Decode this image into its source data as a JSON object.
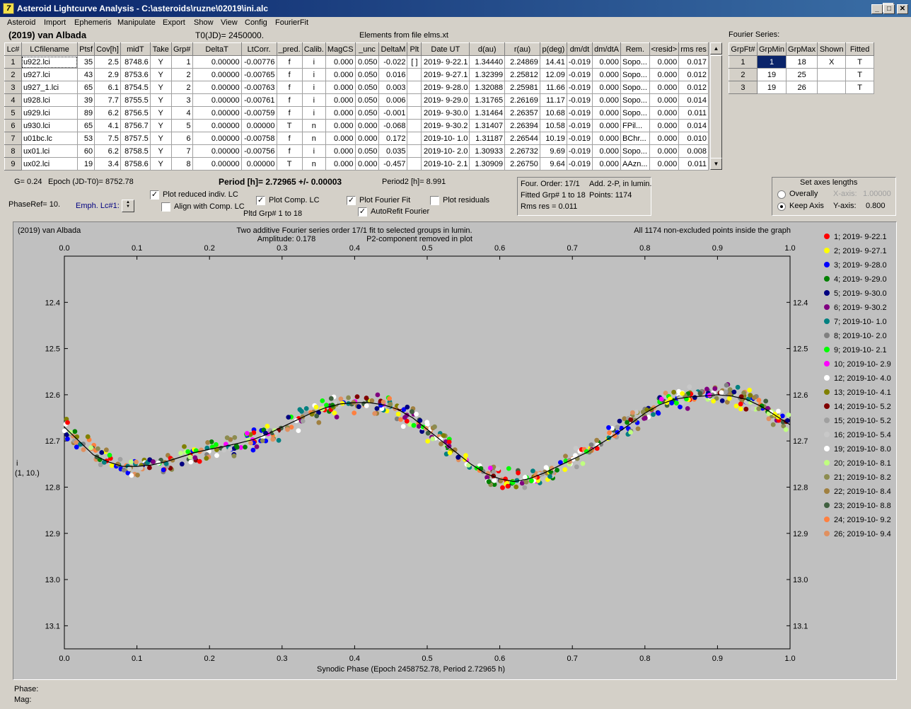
{
  "window": {
    "title": "Asteroid Lightcurve Analysis - C:\\asteroids\\ruzne\\02019\\ini.alc",
    "app_icon": "7"
  },
  "menu": [
    "Asteroid",
    "Import",
    "Ephemeris",
    "Manipulate",
    "Export",
    "Show",
    "View",
    "Config",
    "FourierFit"
  ],
  "header": {
    "asteroid": "(2019) van Albada",
    "t0": "T0(JD)= 2450000.",
    "elements": "Elements from file elms.xt",
    "fourier_title": "Fourier Series:"
  },
  "lc_table": {
    "columns": [
      "Lc#",
      "LCfilename",
      "Ptsf",
      "Cov[h]",
      "midT",
      "Take",
      "Grp#",
      "DeltaT",
      "LtCorr.",
      "_pred.",
      "Calib.",
      "MagCS",
      "_unc",
      "DeltaM",
      "Plt",
      "Date UT",
      "d(au)",
      "r(au)",
      "p(deg)",
      "dm/dt",
      "dm/dtA",
      "Rem.",
      "<resid>",
      "rms res"
    ],
    "rows": [
      [
        "1",
        "u922.lci",
        "35",
        "2.5",
        "8748.6",
        "Y",
        "1",
        "0.00000",
        "-0.00776",
        "f",
        "i",
        "0.000",
        "0.050",
        "-0.022",
        "[ ]",
        "2019- 9-22.1",
        "1.34440",
        "2.24869",
        "14.41",
        "-0.019",
        "0.000",
        "Sopo...",
        "0.000",
        "0.017"
      ],
      [
        "2",
        "u927.lci",
        "43",
        "2.9",
        "8753.6",
        "Y",
        "2",
        "0.00000",
        "-0.00765",
        "f",
        "i",
        "0.000",
        "0.050",
        "0.016",
        "",
        "2019- 9-27.1",
        "1.32399",
        "2.25812",
        "12.09",
        "-0.019",
        "0.000",
        "Sopo...",
        "0.000",
        "0.012"
      ],
      [
        "3",
        "u927_1.lci",
        "65",
        "6.1",
        "8754.5",
        "Y",
        "2",
        "0.00000",
        "-0.00763",
        "f",
        "i",
        "0.000",
        "0.050",
        "0.003",
        "",
        "2019- 9-28.0",
        "1.32088",
        "2.25981",
        "11.66",
        "-0.019",
        "0.000",
        "Sopo...",
        "0.000",
        "0.012"
      ],
      [
        "4",
        "u928.lci",
        "39",
        "7.7",
        "8755.5",
        "Y",
        "3",
        "0.00000",
        "-0.00761",
        "f",
        "i",
        "0.000",
        "0.050",
        "0.006",
        "",
        "2019- 9-29.0",
        "1.31765",
        "2.26169",
        "11.17",
        "-0.019",
        "0.000",
        "Sopo...",
        "0.000",
        "0.014"
      ],
      [
        "5",
        "u929.lci",
        "89",
        "6.2",
        "8756.5",
        "Y",
        "4",
        "0.00000",
        "-0.00759",
        "f",
        "i",
        "0.000",
        "0.050",
        "-0.001",
        "",
        "2019- 9-30.0",
        "1.31464",
        "2.26357",
        "10.68",
        "-0.019",
        "0.000",
        "Sopo...",
        "0.000",
        "0.011"
      ],
      [
        "6",
        "u930.lci",
        "65",
        "4.1",
        "8756.7",
        "Y",
        "5",
        "0.00000",
        "0.00000",
        "T",
        "n",
        "0.000",
        "0.000",
        "-0.068",
        "",
        "2019- 9-30.2",
        "1.31407",
        "2.26394",
        "10.58",
        "-0.019",
        "0.000",
        "FPil...",
        "0.000",
        "0.014"
      ],
      [
        "7",
        "u01bc.lc",
        "53",
        "7.5",
        "8757.5",
        "Y",
        "6",
        "0.00000",
        "-0.00758",
        "f",
        "n",
        "0.000",
        "0.000",
        "0.172",
        "",
        "2019-10- 1.0",
        "1.31187",
        "2.26544",
        "10.19",
        "-0.019",
        "0.000",
        "BChr...",
        "0.000",
        "0.010"
      ],
      [
        "8",
        "ux01.lci",
        "60",
        "6.2",
        "8758.5",
        "Y",
        "7",
        "0.00000",
        "-0.00756",
        "f",
        "i",
        "0.000",
        "0.050",
        "0.035",
        "",
        "2019-10- 2.0",
        "1.30933",
        "2.26732",
        "9.69",
        "-0.019",
        "0.000",
        "Sopo...",
        "0.000",
        "0.008"
      ],
      [
        "9",
        "ux02.lci",
        "19",
        "3.4",
        "8758.6",
        "Y",
        "8",
        "0.00000",
        "0.00000",
        "T",
        "n",
        "0.000",
        "0.000",
        "-0.457",
        "",
        "2019-10- 2.1",
        "1.30909",
        "2.26750",
        "9.64",
        "-0.019",
        "0.000",
        "AAzn...",
        "0.000",
        "0.011"
      ]
    ]
  },
  "fourier_table": {
    "columns": [
      "GrpFt#",
      "GrpMin",
      "GrpMax",
      "Shown",
      "Fitted"
    ],
    "rows": [
      [
        "1",
        "1",
        "18",
        "X",
        "T"
      ],
      [
        "2",
        "19",
        "25",
        "",
        "T"
      ],
      [
        "3",
        "19",
        "26",
        "",
        "T"
      ]
    ]
  },
  "info": {
    "g": "G= 0.24",
    "epoch": "Epoch (JD-T0)= 8752.78",
    "period": "Period [h]= 2.72965 +/- 0.00003",
    "period2": "Period2 [h]= 8.991",
    "phaseref": "PhaseRef= 10.",
    "emph": "Emph. Lc#1:",
    "plot_reduced": "Plot reduced indiv. LC",
    "align_comp": "Align with Comp. LC",
    "plot_comp": "Plot Comp. LC",
    "plot_fourier": "Plot Fourier Fit",
    "autorefit": "AutoRefit Fourier",
    "plot_residuals": "Plot residuals",
    "plotted_grp": "Pltd Grp#  1   to   18",
    "four_order": "Four. Order: 17/1",
    "add_2p": "Add. 2-P, in lumin.",
    "fitted_grp": "Fitted Grp# 1 to 18",
    "points": "Points: 1174",
    "rms": "Rms res      = 0.011",
    "axes_title": "Set axes lengths",
    "overally": "Overally",
    "keep_axis": "Keep Axis",
    "xaxis_label": "X-axis:",
    "xaxis_val": "1.00000",
    "yaxis_label": "Y-axis:",
    "yaxis_val": "0.800"
  },
  "checks": {
    "plot_reduced": true,
    "align_comp": false,
    "plot_comp": true,
    "plot_fourier": true,
    "autorefit": true,
    "plot_residuals": false,
    "keep_axis": true
  },
  "plot": {
    "left_title": "(2019) van Albada",
    "center_title": "Two additive Fourier series order 17/1 fit to selected groups in lumin.",
    "amplitude": "Amplitude: 0.178",
    "p2note": "P2-component removed in plot",
    "right_title": "All 1174 non-excluded points inside the graph",
    "xlabel": "Synodic Phase (Epoch 2458752.78, Period 2.72965 h)",
    "ylabel_1": "i",
    "ylabel_2": "(1, 10.)"
  },
  "status": {
    "phase": "Phase:",
    "mag": "Mag:"
  },
  "chart_data": {
    "type": "scatter",
    "xlim": [
      0.0,
      1.0
    ],
    "ylim": [
      12.3,
      13.15
    ],
    "y_inverted": true,
    "xticks": [
      "0.0",
      "0.1",
      "0.2",
      "0.3",
      "0.4",
      "0.5",
      "0.6",
      "0.7",
      "0.8",
      "0.9",
      "1.0"
    ],
    "yticks": [
      "12.4",
      "12.5",
      "12.6",
      "12.7",
      "12.8",
      "12.9",
      "13.0",
      "13.1"
    ],
    "fit_curve": {
      "x": [
        0.0,
        0.02,
        0.04,
        0.06,
        0.08,
        0.1,
        0.12,
        0.14,
        0.16,
        0.18,
        0.2,
        0.22,
        0.24,
        0.26,
        0.28,
        0.3,
        0.32,
        0.34,
        0.36,
        0.38,
        0.4,
        0.42,
        0.44,
        0.46,
        0.48,
        0.5,
        0.52,
        0.54,
        0.56,
        0.58,
        0.6,
        0.62,
        0.64,
        0.66,
        0.68,
        0.7,
        0.72,
        0.74,
        0.76,
        0.78,
        0.8,
        0.82,
        0.84,
        0.86,
        0.88,
        0.9,
        0.92,
        0.94,
        0.96,
        0.98,
        1.0
      ],
      "y": [
        12.67,
        12.7,
        12.73,
        12.745,
        12.755,
        12.755,
        12.752,
        12.745,
        12.735,
        12.725,
        12.718,
        12.712,
        12.705,
        12.697,
        12.685,
        12.67,
        12.655,
        12.64,
        12.628,
        12.62,
        12.617,
        12.617,
        12.622,
        12.632,
        12.65,
        12.675,
        12.7,
        12.725,
        12.75,
        12.77,
        12.782,
        12.788,
        12.782,
        12.77,
        12.755,
        12.74,
        12.725,
        12.705,
        12.685,
        12.663,
        12.64,
        12.622,
        12.61,
        12.605,
        12.603,
        12.6,
        12.603,
        12.61,
        12.625,
        12.645,
        12.665
      ]
    },
    "series": [
      {
        "name": "1; 2019- 9-22.1",
        "color": "#ff0000"
      },
      {
        "name": "2; 2019- 9-27.1",
        "color": "#ffff00"
      },
      {
        "name": "3; 2019- 9-28.0",
        "color": "#0000ff"
      },
      {
        "name": "4; 2019- 9-29.0",
        "color": "#008000"
      },
      {
        "name": "5; 2019- 9-30.0",
        "color": "#000080"
      },
      {
        "name": "6; 2019- 9-30.2",
        "color": "#800080"
      },
      {
        "name": "7; 2019-10- 1.0",
        "color": "#008080"
      },
      {
        "name": "8; 2019-10- 2.0",
        "color": "#808080"
      },
      {
        "name": "9; 2019-10- 2.1",
        "color": "#00ff00"
      },
      {
        "name": "10; 2019-10- 2.9",
        "color": "#ff00ff"
      },
      {
        "name": "12; 2019-10- 4.0",
        "color": "#ffffff"
      },
      {
        "name": "13; 2019-10- 4.1",
        "color": "#808000"
      },
      {
        "name": "14; 2019-10- 5.2",
        "color": "#800000"
      },
      {
        "name": "15; 2019-10- 5.2",
        "color": "#a0a0a0"
      },
      {
        "name": "16; 2019-10- 5.4",
        "color": "#c8c8c8"
      },
      {
        "name": "19; 2019-10- 8.0",
        "color": "#ffffff"
      },
      {
        "name": "20; 2019-10- 8.1",
        "color": "#c0ff80"
      },
      {
        "name": "21; 2019-10- 8.2",
        "color": "#8c8c50"
      },
      {
        "name": "22; 2019-10- 8.4",
        "color": "#a08040"
      },
      {
        "name": "23; 2019-10- 8.8",
        "color": "#406040"
      },
      {
        "name": "24; 2019-10- 9.2",
        "color": "#ff8040"
      },
      {
        "name": "26; 2019-10- 9.4",
        "color": "#e09060"
      }
    ]
  }
}
